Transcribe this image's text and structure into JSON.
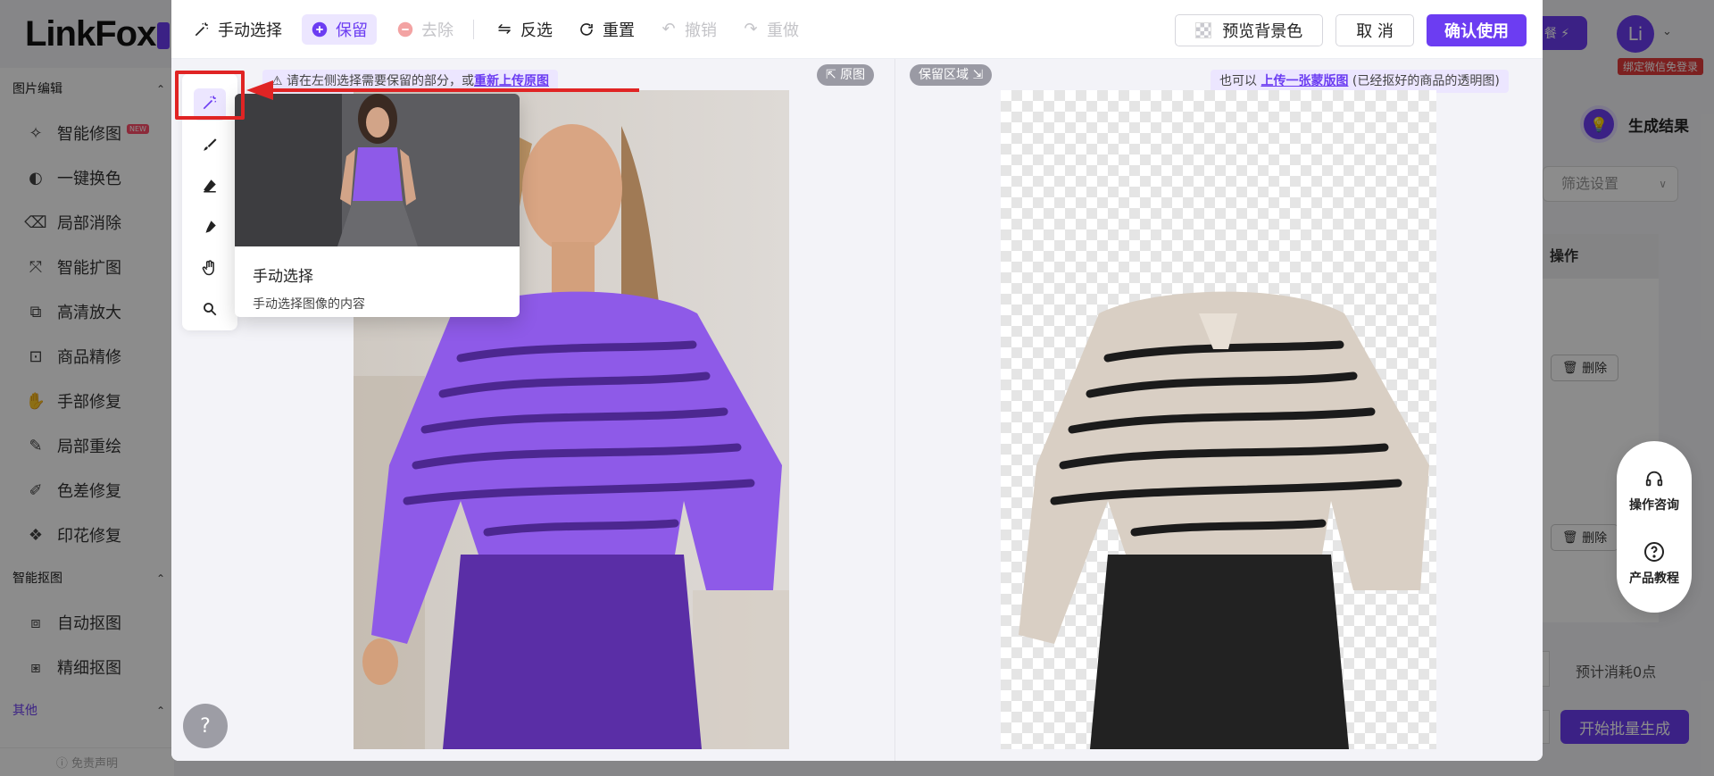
{
  "app": {
    "logo_text": "LinkFox",
    "vip_button": "餐 ⚡",
    "avatar_initial": "Li",
    "wechat_badge": "绑定微信免登录"
  },
  "sidebar": {
    "groups": [
      {
        "label": "图片编辑",
        "items": [
          {
            "label": "智能修图",
            "icon": "magic-retouch-icon",
            "badge": "NEW"
          },
          {
            "label": "一键换色",
            "icon": "color-swap-icon"
          },
          {
            "label": "局部消除",
            "icon": "eraser-icon"
          },
          {
            "label": "智能扩图",
            "icon": "expand-icon"
          },
          {
            "label": "高清放大",
            "icon": "upscale-icon"
          },
          {
            "label": "商品精修",
            "icon": "product-retouch-icon"
          },
          {
            "label": "手部修复",
            "icon": "hand-icon"
          },
          {
            "label": "局部重绘",
            "icon": "redraw-icon"
          },
          {
            "label": "色差修复",
            "icon": "color-fix-icon"
          },
          {
            "label": "印花修复",
            "icon": "print-fix-icon"
          }
        ]
      },
      {
        "label": "智能抠图",
        "items": [
          {
            "label": "自动抠图",
            "icon": "auto-cutout-icon"
          },
          {
            "label": "精细抠图",
            "icon": "fine-cutout-icon"
          }
        ]
      },
      {
        "label": "其他",
        "items": []
      }
    ],
    "footer": "ⓘ 免责声明"
  },
  "right_panel": {
    "result_title": "生成结果",
    "filter_placeholder": "筛选设置",
    "op_header": "操作",
    "delete_label": "删除",
    "float_consult": "操作咨询",
    "float_tutorial": "产品教程",
    "cost_text": "预计消耗0点",
    "batch_button": "开始批量生成"
  },
  "modal": {
    "toolbar": {
      "manual_select": "手动选择",
      "keep": "保留",
      "remove": "去除",
      "invert": "反选",
      "reset": "重置",
      "undo": "撤销",
      "redo": "重做",
      "preview_bg": "预览背景色",
      "cancel": "取 消",
      "confirm": "确认使用"
    },
    "left_pane": {
      "hint_prefix": "请在左侧选择需要保留的部分，或",
      "hint_link": "重新上传原图",
      "tag": "⇱ 原图"
    },
    "right_pane": {
      "tag": "保留区域 ⇲",
      "hint_prefix": "也可以",
      "hint_link": "上传一张蒙版图",
      "hint_suffix": "(已经抠好的商品的透明图)"
    },
    "tooltip": {
      "title": "手动选择",
      "description": "手动选择图像的内容"
    },
    "help_label": "?"
  },
  "colors": {
    "brand": "#6c3df2",
    "brand_light": "#ece6ff",
    "annotation_red": "#e02424",
    "disabled": "#c4c4c8",
    "sweater_purple": "#8e5ae8",
    "pants_purple": "#5a2ea6",
    "sweater_cream": "#d9cfc4"
  }
}
